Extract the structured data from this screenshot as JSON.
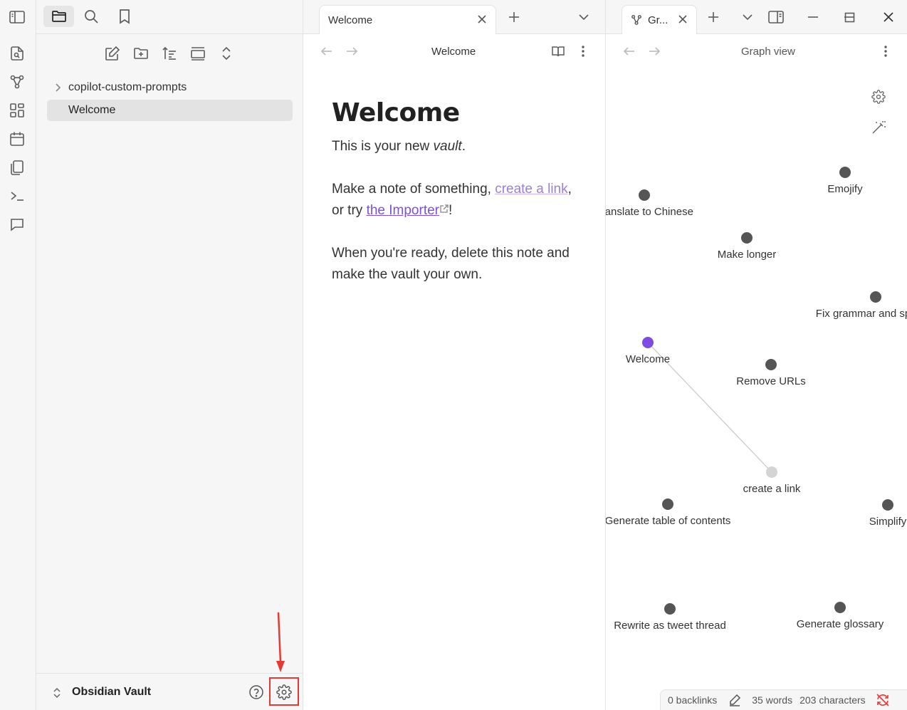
{
  "ribbon": {
    "icons": [
      "toggle-sidebar-icon",
      "open-quick-switcher-icon",
      "graph-view-icon",
      "canvas-icon",
      "daily-notes-icon",
      "templates-icon",
      "command-palette-icon",
      "chat-icon"
    ]
  },
  "sidebar": {
    "tabs": [
      "files-icon",
      "search-icon",
      "bookmarks-icon"
    ],
    "actions": [
      "new-note-icon",
      "new-folder-icon",
      "sort-icon",
      "auto-reveal-icon",
      "collapse-all-icon"
    ],
    "tree": [
      {
        "label": "copilot-custom-prompts",
        "type": "folder"
      },
      {
        "label": "Welcome",
        "type": "file",
        "active": true
      }
    ],
    "vault_name": "Obsidian Vault"
  },
  "editor": {
    "tab_title": "Welcome",
    "view_title": "Welcome",
    "note": {
      "heading": "Welcome",
      "p1_prefix": "This is your new ",
      "p1_em": "vault",
      "p1_suffix": ".",
      "p2_prefix": "Make a note of something, ",
      "p2_link1": "create a link",
      "p2_mid": ", or try ",
      "p2_link2": "the Importer",
      "p2_suffix": "!",
      "p3": "When you're ready, delete this note and make the vault your own."
    }
  },
  "graph": {
    "tab_title": "Gr...",
    "view_title": "Graph view",
    "colors": {
      "node": "#555555",
      "active_node": "#7c4dde",
      "unresolved_node": "#d4d4d4",
      "edge": "#cccccc"
    },
    "nodes": [
      {
        "label": "Translate to Chinese"
      },
      {
        "label": "Emojify"
      },
      {
        "label": "Make longer"
      },
      {
        "label": "Fix grammar and spelling"
      },
      {
        "label": "Welcome",
        "active": true
      },
      {
        "label": "Remove URLs"
      },
      {
        "label": "create a link",
        "unresolved": true
      },
      {
        "label": "Generate table of contents"
      },
      {
        "label": "Simplify"
      },
      {
        "label": "Rewrite as tweet thread"
      },
      {
        "label": "Generate glossary"
      }
    ]
  },
  "status": {
    "backlinks": "0 backlinks",
    "words": "35 words",
    "characters": "203 characters"
  },
  "accent": "#e53935"
}
